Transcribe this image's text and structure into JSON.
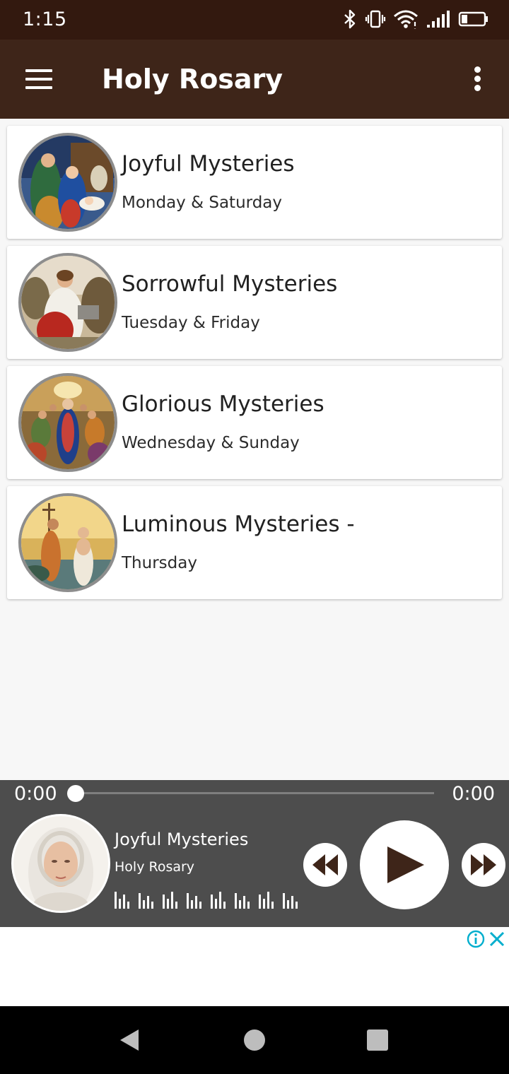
{
  "status_bar": {
    "time": "1:15",
    "icons": [
      "bluetooth-icon",
      "vibrate-icon",
      "wifi-icon",
      "cell-signal-icon",
      "battery-icon"
    ]
  },
  "app_bar": {
    "title": "Holy Rosary",
    "menu_icon": "hamburger-menu-icon",
    "overflow_icon": "more-vert-icon",
    "background": "#3e2519"
  },
  "mysteries": [
    {
      "title": "Joyful Mysteries",
      "subtitle": "Monday & Saturday",
      "image": "nativity-painting"
    },
    {
      "title": "Sorrowful Mysteries",
      "subtitle": "Tuesday & Friday",
      "image": "agony-in-garden-painting"
    },
    {
      "title": "Glorious Mysteries",
      "subtitle": "Wednesday & Sunday",
      "image": "pentecost-painting"
    },
    {
      "title": "Luminous Mysteries -",
      "subtitle": "Thursday",
      "image": "baptism-of-jesus-painting"
    }
  ],
  "player": {
    "elapsed": "0:00",
    "duration": "0:00",
    "progress": 0,
    "track_title": "Joyful Mysteries",
    "track_artist": "Holy Rosary",
    "artwork": "virgin-mary-portrait",
    "background": "#4d4d4d",
    "controls": [
      "rewind-icon",
      "play-icon",
      "fast-forward-icon"
    ],
    "play_icon_color": "#3e2519"
  },
  "ad": {
    "info_icon": "ad-info-icon",
    "close_icon": "ad-close-icon",
    "accent": "#00aecd"
  },
  "nav_bar": {
    "buttons": [
      "back-icon",
      "home-icon",
      "recents-icon"
    ]
  }
}
